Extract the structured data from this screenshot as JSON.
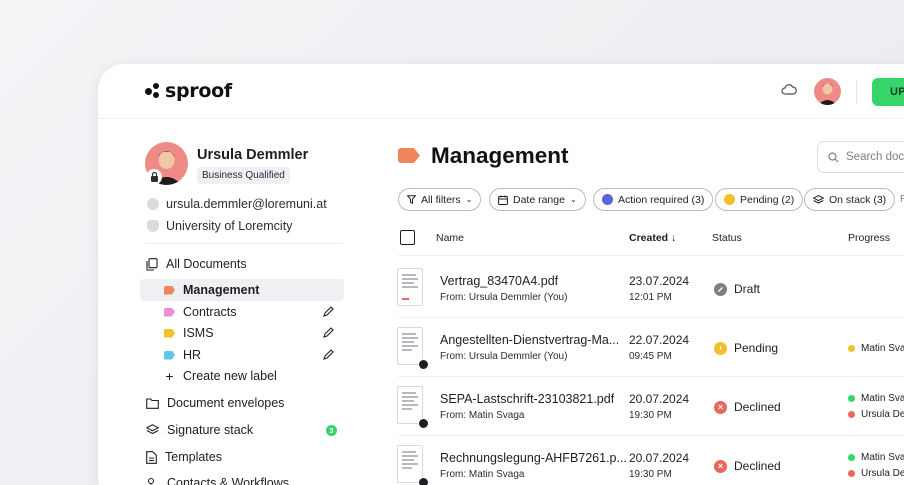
{
  "app": {
    "logo_text": "sproof"
  },
  "topbar": {
    "upload_label": "UPL",
    "cloud_icon": "cloud-icon"
  },
  "user": {
    "name": "Ursula Demmler",
    "badge": "Business Qualified",
    "email": "ursula.demmler@loremuni.at",
    "organization": "University of Loremcity"
  },
  "sidebar": {
    "all_documents": "All Documents",
    "labels": [
      {
        "label": "Management",
        "color": "#f0845c"
      },
      {
        "label": "Contracts",
        "color": "#ec8fd9"
      },
      {
        "label": "ISMS",
        "color": "#f2c02a"
      },
      {
        "label": "HR",
        "color": "#5ec8e0"
      }
    ],
    "create_label": "Create new label",
    "document_envelopes": "Document envelopes",
    "signature_stack": "Signature stack",
    "signature_stack_count": "3",
    "templates": "Templates",
    "contacts": "Contacts & Workflows"
  },
  "main": {
    "title": "Management",
    "search_placeholder": "Search docu",
    "filters": {
      "all": "All filters",
      "date": "Date range",
      "action": "Action required (3)",
      "pending": "Pending (2)",
      "stack": "On stack (3)",
      "more": "R"
    },
    "columns": {
      "name": "Name",
      "created": "Created ↓",
      "status": "Status",
      "progress": "Progress"
    },
    "rows": [
      {
        "name": "Vertrag_83470A4.pdf",
        "from": "From: Ursula Demmler (You)",
        "date": "23.07.2024",
        "time": "12:01 PM",
        "status": "Draft",
        "progress": []
      },
      {
        "name": "Angestellten-Dienstvertrag-Ma...",
        "from": "From: Ursula Demmler (You)",
        "date": "22.07.2024",
        "time": "09:45 PM",
        "status": "Pending",
        "progress": [
          "Matin Sva"
        ]
      },
      {
        "name": "SEPA-Lastschrift-23103821.pdf",
        "from": "From: Matin Svaga",
        "date": "20.07.2024",
        "time": "19:30 PM",
        "status": "Declined",
        "progress": [
          "Matin Sva",
          "Ursula De"
        ]
      },
      {
        "name": "Rechnungslegung-AHFB7261.p...",
        "from": "From: Matin Svaga",
        "date": "20.07.2024",
        "time": "19:30 PM",
        "status": "Declined",
        "progress": [
          "Matin Sva",
          "Ursula De"
        ]
      }
    ]
  },
  "colors": {
    "accent_green": "#37d469",
    "draft": "#7b7f87",
    "pending": "#f2c02a",
    "declined": "#e8685c",
    "purple": "#5b63d9"
  }
}
